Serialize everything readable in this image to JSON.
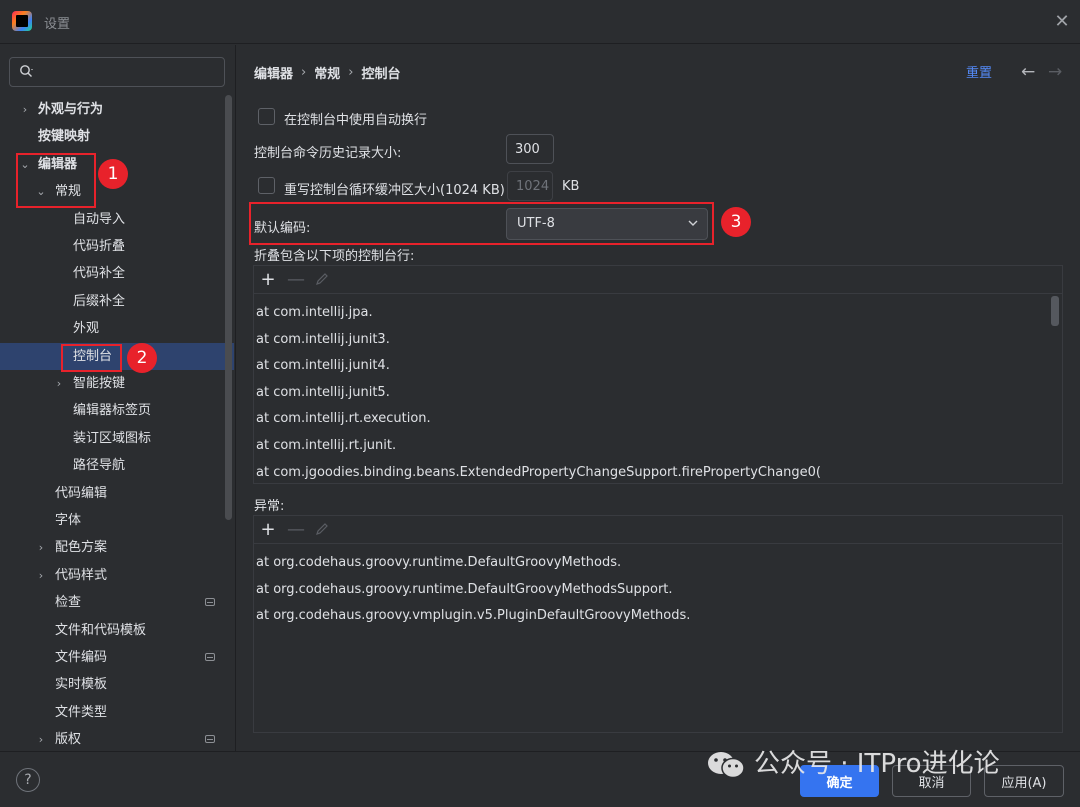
{
  "window": {
    "title": "设置",
    "icon": "intellij-app-icon",
    "close": "✕"
  },
  "sidebar": {
    "search": {
      "value": "",
      "placeholder": ""
    },
    "items": [
      {
        "label": "外观与行为",
        "chevron": "›",
        "expanded": false,
        "bold": true
      },
      {
        "label": "按键映射",
        "chevron": "",
        "bold": true
      },
      {
        "label": "编辑器",
        "chevron": "⌄",
        "expanded": true,
        "bold": true
      },
      {
        "label": "常规",
        "chevron": "⌄",
        "expanded": true
      },
      {
        "label": "自动导入",
        "chevron": ""
      },
      {
        "label": "代码折叠",
        "chevron": ""
      },
      {
        "label": "代码补全",
        "chevron": ""
      },
      {
        "label": "后缀补全",
        "chevron": ""
      },
      {
        "label": "外观",
        "chevron": ""
      },
      {
        "label": "控制台",
        "chevron": "",
        "selected": true
      },
      {
        "label": "智能按键",
        "chevron": "›"
      },
      {
        "label": "编辑器标签页",
        "chevron": ""
      },
      {
        "label": "装订区域图标",
        "chevron": ""
      },
      {
        "label": "路径导航",
        "chevron": ""
      },
      {
        "label": "代码编辑",
        "chevron": ""
      },
      {
        "label": "字体",
        "chevron": ""
      },
      {
        "label": "配色方案",
        "chevron": "›"
      },
      {
        "label": "代码样式",
        "chevron": "›"
      },
      {
        "label": "检查",
        "chevron": "",
        "badge": true
      },
      {
        "label": "文件和代码模板",
        "chevron": ""
      },
      {
        "label": "文件编码",
        "chevron": "",
        "badge": true
      },
      {
        "label": "实时模板",
        "chevron": ""
      },
      {
        "label": "文件类型",
        "chevron": ""
      },
      {
        "label": "版权",
        "chevron": "›",
        "badge": true
      }
    ]
  },
  "breadcrumb": {
    "items": [
      "编辑器",
      "常规",
      "控制台"
    ],
    "separator": "›"
  },
  "header": {
    "reset_label": "重置",
    "back": "←",
    "forward": "→"
  },
  "settings": {
    "soft_wrap": {
      "label": "在控制台中使用自动换行",
      "checked": false
    },
    "history_size": {
      "label": "控制台命令历史记录大小:",
      "value": "300"
    },
    "override_buffer": {
      "label": "重写控制台循环缓冲区大小(1024 KB)",
      "checked": false,
      "value": "1024",
      "unit": "KB"
    },
    "default_encoding": {
      "label": "默认编码:",
      "value": "UTF-8"
    },
    "fold_lines": {
      "label": "折叠包含以下项的控制台行:",
      "rows": [
        "at com.intellij.jpa.",
        "at com.intellij.junit3.",
        "at com.intellij.junit4.",
        "at com.intellij.junit5.",
        "at com.intellij.rt.execution.",
        "at com.intellij.rt.junit.",
        "at com.jgoodies.binding.beans.ExtendedPropertyChangeSupport.firePropertyChange0("
      ]
    },
    "exceptions": {
      "label": "异常:",
      "rows": [
        "at org.codehaus.groovy.runtime.DefaultGroovyMethods.",
        "at org.codehaus.groovy.runtime.DefaultGroovyMethodsSupport.",
        "at org.codehaus.groovy.vmplugin.v5.PluginDefaultGroovyMethods."
      ]
    },
    "toolbar": {
      "add": "+",
      "remove": "—"
    }
  },
  "footer": {
    "help": "?",
    "ok_label": "确定",
    "cancel_label": "取消",
    "apply_label": "应用(A)"
  },
  "annotations": [
    "1",
    "2",
    "3"
  ],
  "watermark": {
    "text": "公众号 · ITPro进化论"
  },
  "colors": {
    "accent": "#3574f0",
    "selection": "#2e436e",
    "annotation": "#e8222b",
    "link": "#548af7",
    "background": "#2b2d30"
  }
}
